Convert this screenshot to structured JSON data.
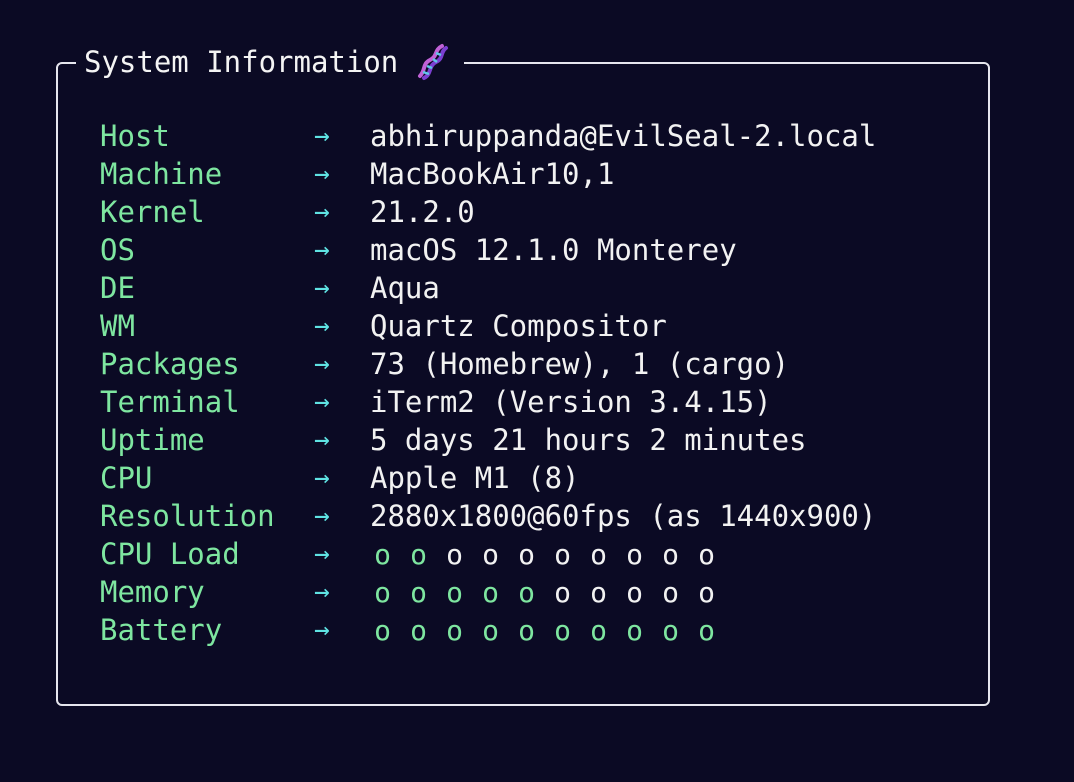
{
  "panel": {
    "title": "System Information",
    "title_icon": "dna-icon"
  },
  "arrow": "→",
  "dot_glyph": "o",
  "rows": [
    {
      "label": "Host",
      "value": "abhiruppanda@EvilSeal-2.local"
    },
    {
      "label": "Machine",
      "value": "MacBookAir10,1"
    },
    {
      "label": "Kernel",
      "value": "21.2.0"
    },
    {
      "label": "OS",
      "value": "macOS 12.1.0 Monterey"
    },
    {
      "label": "DE",
      "value": "Aqua"
    },
    {
      "label": "WM",
      "value": "Quartz Compositor"
    },
    {
      "label": "Packages",
      "value": "73 (Homebrew), 1 (cargo)"
    },
    {
      "label": "Terminal",
      "value": "iTerm2 (Version 3.4.15)"
    },
    {
      "label": "Uptime",
      "value": "5 days 21 hours 2 minutes"
    },
    {
      "label": "CPU",
      "value": "Apple M1 (8)"
    },
    {
      "label": "Resolution",
      "value": "2880x1800@60fps (as 1440x900)"
    }
  ],
  "meters": [
    {
      "label": "CPU Load",
      "filled": 2,
      "total": 10
    },
    {
      "label": "Memory",
      "filled": 5,
      "total": 10
    },
    {
      "label": "Battery",
      "filled": 10,
      "total": 10
    }
  ],
  "colors": {
    "background": "#0b0a24",
    "label": "#7ee6a0",
    "arrow": "#5fe3e3",
    "value": "#f2f2f2",
    "border": "#e6e6ee",
    "meter_on": "#7ee6a0",
    "meter_off": "#f2f2f2"
  }
}
